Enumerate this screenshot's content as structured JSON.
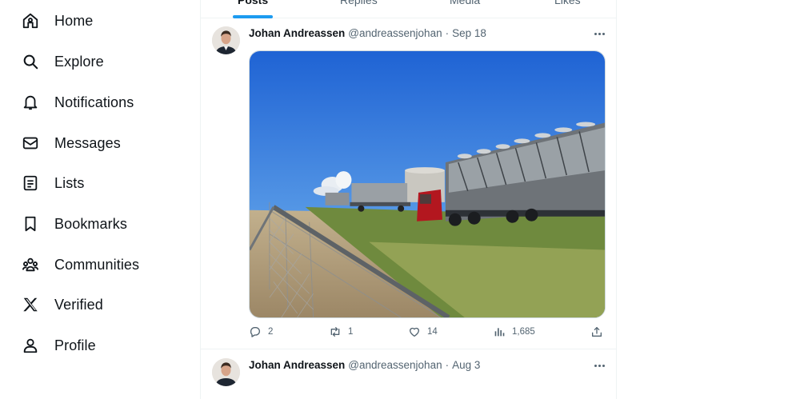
{
  "nav": {
    "items": [
      {
        "label": "Home",
        "icon": "home-icon"
      },
      {
        "label": "Explore",
        "icon": "search-icon"
      },
      {
        "label": "Notifications",
        "icon": "bell-icon"
      },
      {
        "label": "Messages",
        "icon": "envelope-icon"
      },
      {
        "label": "Lists",
        "icon": "list-icon"
      },
      {
        "label": "Bookmarks",
        "icon": "bookmark-icon"
      },
      {
        "label": "Communities",
        "icon": "communities-icon"
      },
      {
        "label": "Verified",
        "icon": "x-logo-icon"
      },
      {
        "label": "Profile",
        "icon": "person-icon"
      }
    ]
  },
  "tabs": [
    {
      "label": "Posts",
      "active": true
    },
    {
      "label": "Replies",
      "active": false
    },
    {
      "label": "Media",
      "active": false
    },
    {
      "label": "Likes",
      "active": false
    }
  ],
  "posts": [
    {
      "author": "Johan Andreassen",
      "handle": "@andreassenjohan",
      "date": "Sep 18",
      "media_description": "photo",
      "replies": "2",
      "reposts": "1",
      "likes": "14",
      "views": "1,685"
    },
    {
      "author": "Johan Andreassen",
      "handle": "@andreassenjohan",
      "date": "Aug 3"
    }
  ],
  "colors": {
    "accent": "#1d9bf0",
    "text_primary": "#0f1419",
    "text_secondary": "#536471",
    "border": "#eff3f4"
  }
}
